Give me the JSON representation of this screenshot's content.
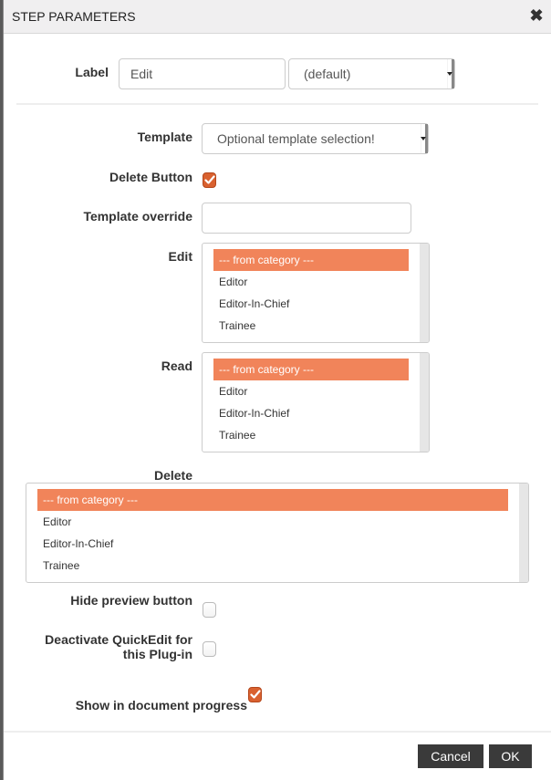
{
  "dialog": {
    "title": "STEP PARAMETERS",
    "close_icon": "close-x-icon"
  },
  "label_row": {
    "label": "Label",
    "input_value": "Edit",
    "select_value": "(default)"
  },
  "template": {
    "label": "Template",
    "select_value": "Optional template selection!"
  },
  "delete_button": {
    "label": "Delete Button",
    "checked": true
  },
  "template_override": {
    "label": "Template override",
    "value": ""
  },
  "edit": {
    "label": "Edit",
    "options": [
      "--- from category ---",
      "Editor",
      "Editor-In-Chief",
      "Trainee"
    ],
    "selected": "--- from category ---"
  },
  "read": {
    "label": "Read",
    "options": [
      "--- from category ---",
      "Editor",
      "Editor-In-Chief",
      "Trainee"
    ],
    "selected": "--- from category ---"
  },
  "delete": {
    "label": "Delete",
    "options": [
      "--- from category ---",
      "Editor",
      "Editor-In-Chief",
      "Trainee"
    ],
    "selected": "--- from category ---"
  },
  "hide_preview": {
    "label": "Hide preview button",
    "checked": false
  },
  "deactivate_quickedit": {
    "label_line1": "Deactivate QuickEdit for",
    "label_line2": "this Plug-in",
    "checked": false
  },
  "show_progress": {
    "label": "Show in document progress",
    "checked": true
  },
  "footer": {
    "cancel_label": "Cancel",
    "ok_label": "OK"
  },
  "colors": {
    "accent_selected": "#f1845a",
    "checkbox_checked": "#d9612f",
    "button_bg": "#3a3a3a"
  }
}
